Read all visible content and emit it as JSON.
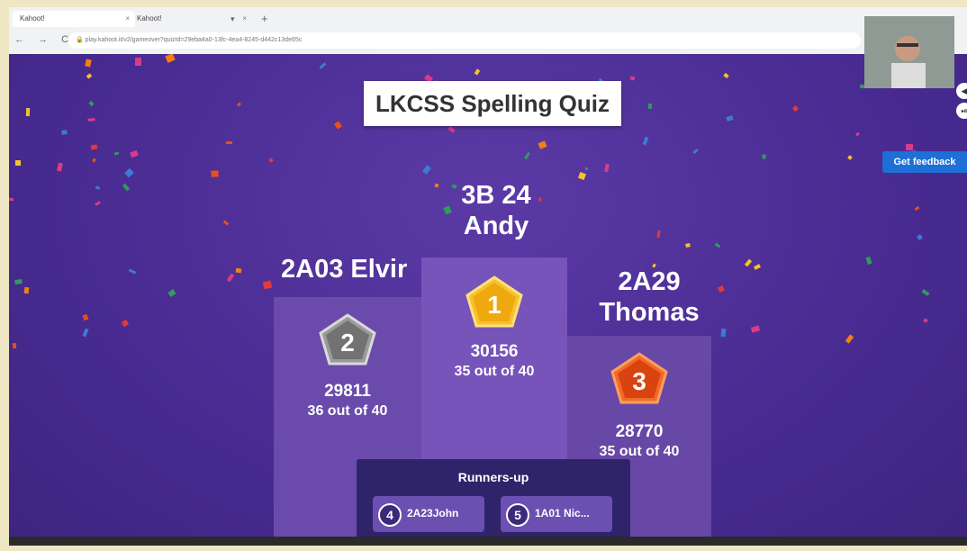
{
  "browser": {
    "tabs": [
      {
        "label": "Kahoot!"
      },
      {
        "label": "Kahoot!"
      }
    ],
    "new_tab_symbol": "+",
    "close_symbol": "×",
    "address": "play.kahoot.it/v2/gameover?quizId=29eba4a0-13fc-4ea4-8245-d442c13de65c",
    "nav_symbols": "← → C"
  },
  "quiz": {
    "title": "LKCSS Spelling Quiz"
  },
  "podium": {
    "first": {
      "rank": "1",
      "name_line1": "3B 24",
      "name_line2": "Andy",
      "score": "30156",
      "correct": "35 out of 40",
      "badge_color": "#f5b814"
    },
    "second": {
      "rank": "2",
      "name": "2A03 Elvir",
      "score": "29811",
      "correct": "36 out of 40",
      "badge_color": "#7a7a7a"
    },
    "third": {
      "rank": "3",
      "name_line1": "2A29",
      "name_line2": "Thomas",
      "score": "28770",
      "correct": "35 out of 40",
      "badge_color": "#e8501a"
    }
  },
  "runners_up": {
    "title": "Runners-up",
    "items": [
      {
        "rank": "4",
        "name": "2A23John"
      },
      {
        "rank": "5",
        "name": "1A01 Nic..."
      }
    ]
  },
  "feedback": {
    "label": "Get feedback"
  },
  "colors": {
    "background": "#4a2c93",
    "feedback": "#1e6fd6"
  }
}
